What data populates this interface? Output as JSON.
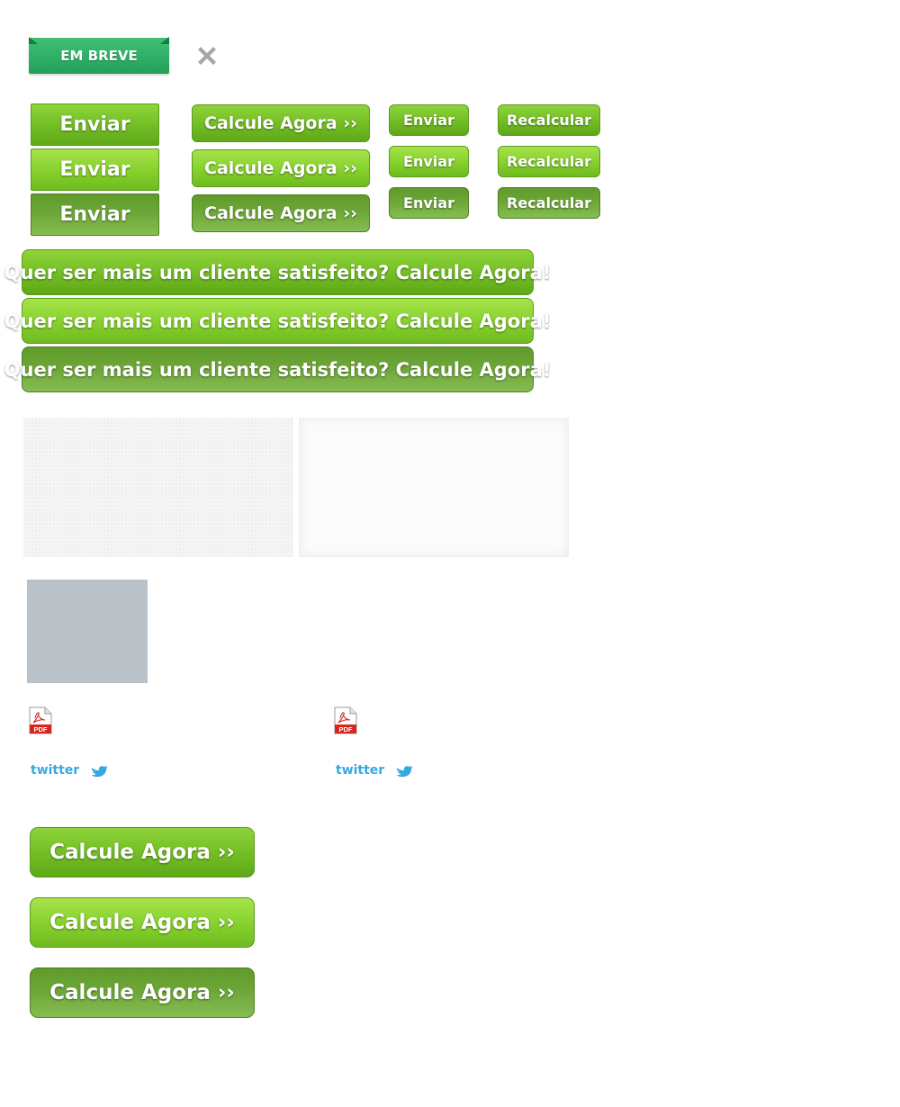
{
  "banner": {
    "label": "EM BREVE"
  },
  "icons": {
    "close": "close-icon",
    "pdf_label": "PDF",
    "twitter": "twitter-logo"
  },
  "buttons": {
    "enviar": "Enviar",
    "calcule_agora": "Calcule Agora ››",
    "recalcular": "Recalcular",
    "cta": "Quer ser mais um cliente satisfeito? Calcule Agora!"
  },
  "colors": {
    "ribbon": "#2bb066",
    "button_green": "#7cc52c",
    "button_pressed": "#6ea23a",
    "twitter_blue": "#36a9e0",
    "pdf_red": "#d7261f"
  }
}
